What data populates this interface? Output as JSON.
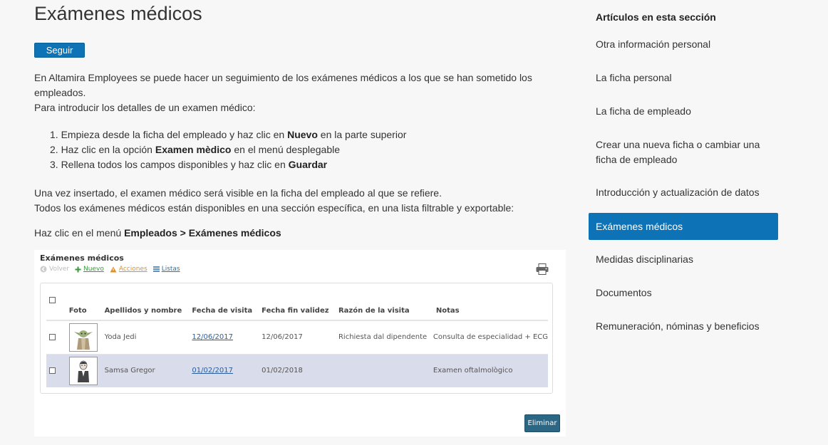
{
  "article": {
    "title": "Exámenes médicos",
    "follow_label": "Seguir",
    "intro_line1": "En Altamira Employees se puede hacer un seguimiento de los exámenes médicos a los que se han sometido los empleados.",
    "intro_line2": "Para introducir los detalles de un examen médico:",
    "steps": [
      {
        "pre": "1. Empieza desde la ficha del empleado y haz clic en ",
        "bold": "Nuevo",
        "post": " en la parte superior"
      },
      {
        "pre": "2. Haz clic en la opción ",
        "bold": "Examen mèdico",
        "post": " en el menú desplegable"
      },
      {
        "pre": "3. Rellena todos los campos disponibles y haz clic en ",
        "bold": "Guardar",
        "post": ""
      }
    ],
    "after_line1": "Una vez insertado, el examen médico será visible en la ficha del empleado al que se refiere.",
    "after_line2": "Todos los exámenes médicos están disponibles en una sección específica, en una lista filtrable y exportable:",
    "menu_pre": "Haz clic en el menú ",
    "menu_path": "Empleados > Exámenes médicos"
  },
  "screenshot": {
    "title": "Exámenes médicos",
    "toolbar": {
      "back": "Volver",
      "new": "Nuevo",
      "actions": "Acciones",
      "lists": "Listas"
    },
    "columns": [
      "Foto",
      "Apellidos y nombre",
      "Fecha de visita",
      "Fecha fin validez",
      "Razón de la visita",
      "Notas"
    ],
    "rows": [
      {
        "name": "Yoda Jedi",
        "visit_date": "12/06/2017",
        "valid_until": "12/06/2017",
        "reason": "Richiesta dal dipendente",
        "notes": "Consulta de especialidad + ECG"
      },
      {
        "name": "Samsa Gregor",
        "visit_date": "01/02/2017",
        "valid_until": "01/02/2018",
        "reason": "",
        "notes": "Examen oftalmològico"
      }
    ],
    "delete_label": "Eliminar",
    "selected_row_color": "#d9dcea"
  },
  "sidebar": {
    "heading": "Artículos en esta sección",
    "items": [
      {
        "label": "Otra información personal"
      },
      {
        "label": "La ficha personal"
      },
      {
        "label": "La ficha de empleado"
      },
      {
        "label": "Crear una nueva ficha o cambiar una ficha de empleado"
      },
      {
        "label": "Introducción y actualización de datos"
      },
      {
        "label": "Exámenes médicos",
        "active": true
      },
      {
        "label": "Medidas disciplinarias"
      },
      {
        "label": "Documentos"
      },
      {
        "label": "Remuneración, nóminas y beneficios"
      }
    ],
    "active_color": "#0d72b6"
  }
}
